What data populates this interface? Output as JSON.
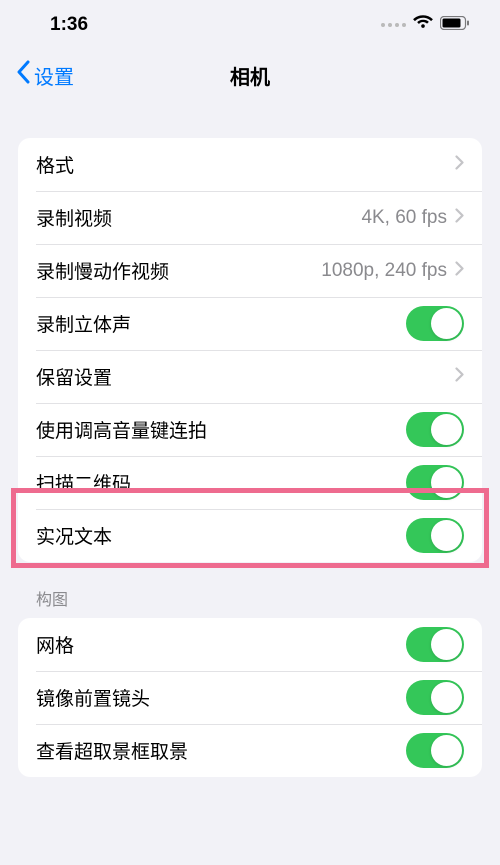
{
  "statusBar": {
    "time": "1:36"
  },
  "nav": {
    "back": "设置",
    "title": "相机"
  },
  "group1": {
    "rows": [
      {
        "label": "格式",
        "type": "disclosure"
      },
      {
        "label": "录制视频",
        "value": "4K, 60 fps",
        "type": "disclosure"
      },
      {
        "label": "录制慢动作视频",
        "value": "1080p, 240 fps",
        "type": "disclosure"
      },
      {
        "label": "录制立体声",
        "type": "toggle",
        "on": true
      },
      {
        "label": "保留设置",
        "type": "disclosure"
      },
      {
        "label": "使用调高音量键连拍",
        "type": "toggle",
        "on": true
      },
      {
        "label": "扫描二维码",
        "type": "toggle",
        "on": true
      },
      {
        "label": "实况文本",
        "type": "toggle",
        "on": true
      }
    ]
  },
  "section2": {
    "header": "构图",
    "rows": [
      {
        "label": "网格",
        "type": "toggle",
        "on": true
      },
      {
        "label": "镜像前置镜头",
        "type": "toggle",
        "on": true
      },
      {
        "label": "查看超取景框取景",
        "type": "toggle",
        "on": true
      }
    ]
  }
}
